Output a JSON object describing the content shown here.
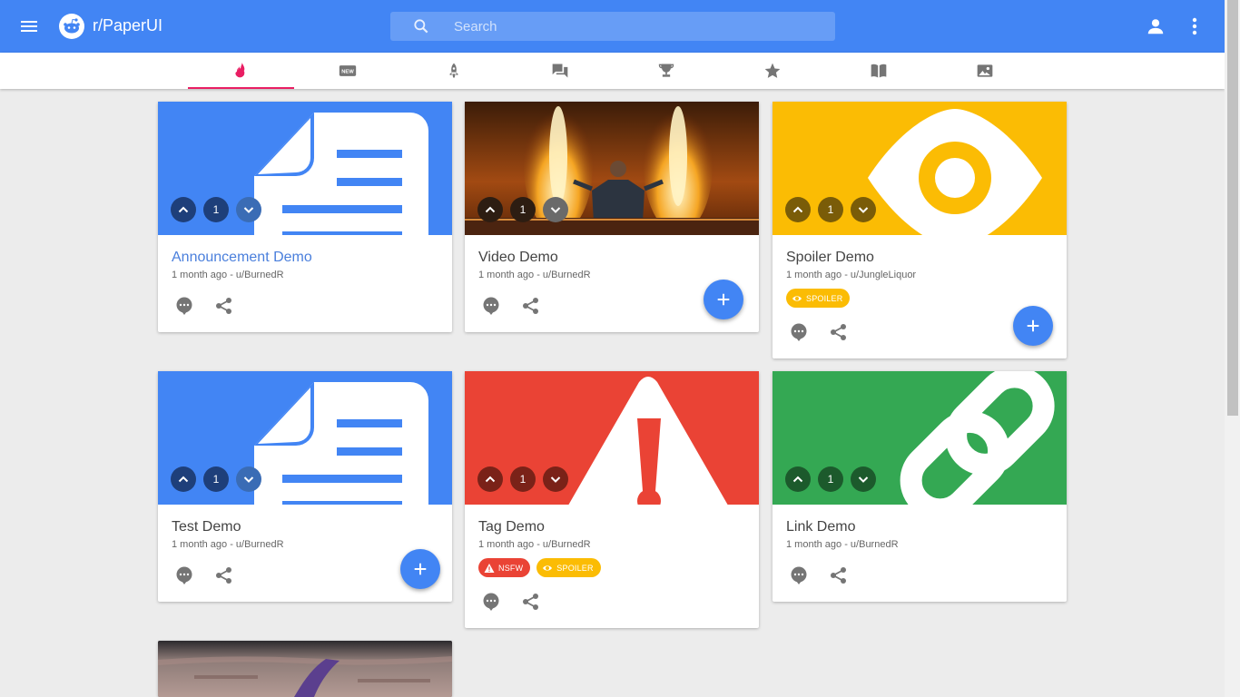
{
  "app": {
    "title": "r/PaperUI"
  },
  "search": {
    "placeholder": "Search"
  },
  "icons": {
    "menu": "menu-icon",
    "logo": "reddit-logo-icon",
    "search": "search-icon",
    "account": "account-icon",
    "more": "more-vert-icon"
  },
  "tabs": [
    {
      "name": "hot",
      "icon": "flame-icon",
      "active": true
    },
    {
      "name": "new",
      "icon": "new-badge-icon"
    },
    {
      "name": "rising",
      "icon": "rocket-icon"
    },
    {
      "name": "controversial",
      "icon": "forum-icon"
    },
    {
      "name": "top",
      "icon": "trophy-icon"
    },
    {
      "name": "gilded",
      "icon": "star-icon"
    },
    {
      "name": "wiki",
      "icon": "book-icon"
    },
    {
      "name": "gallery",
      "icon": "image-icon"
    }
  ],
  "colors": {
    "primary": "#4285f4",
    "tab_indicator": "#e91e63",
    "spoiler": "#fbbc04",
    "nsfw": "#ea4335",
    "link": "#34a853"
  },
  "posts": [
    {
      "title": "Announcement Demo",
      "meta": "1 month ago - u/BurnedR",
      "score": "1",
      "thumb": "document-icon"
    },
    {
      "title": "Video Demo",
      "meta": "1 month ago - u/BurnedR",
      "score": "1",
      "thumb": "video-still"
    },
    {
      "title": "Spoiler Demo",
      "meta": "1 month ago - u/JungleLiquor",
      "score": "1",
      "thumb": "eye-icon",
      "tags": [
        "SPOILER"
      ]
    },
    {
      "title": "Test Demo",
      "meta": "1 month ago - u/BurnedR",
      "score": "1",
      "thumb": "document-icon"
    },
    {
      "title": "Tag Demo",
      "meta": "1 month ago - u/BurnedR",
      "score": "1",
      "thumb": "warning-icon",
      "tags": [
        "NSFW",
        "SPOILER"
      ]
    },
    {
      "title": "Link Demo",
      "meta": "1 month ago - u/BurnedR",
      "score": "1",
      "thumb": "link-icon"
    }
  ]
}
